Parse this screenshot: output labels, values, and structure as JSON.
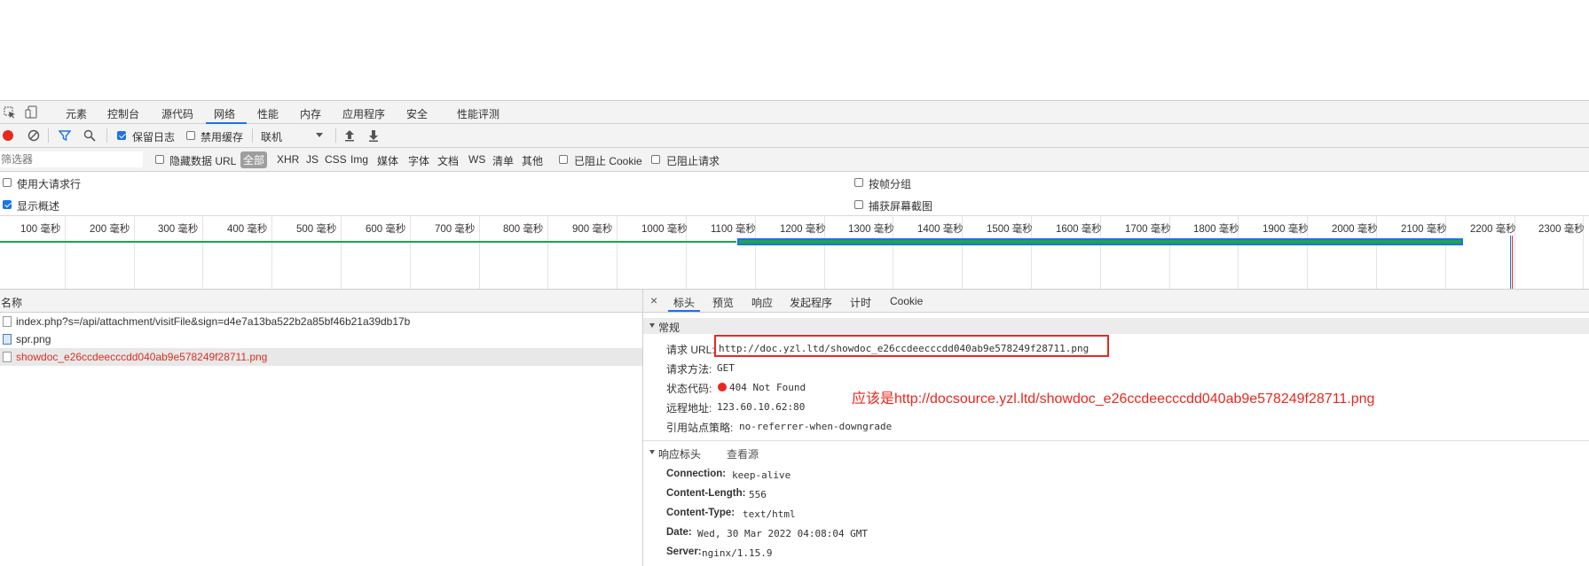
{
  "tabs": {
    "items": [
      "元素",
      "控制台",
      "源代码",
      "网络",
      "性能",
      "内存",
      "应用程序",
      "安全",
      "性能评测"
    ],
    "active_index": 3
  },
  "toolbar": {
    "preserve_log": "保留日志",
    "disable_cache": "禁用缓存",
    "throttling": "联机"
  },
  "filterbar": {
    "placeholder": "筛选器",
    "hide_data_url": "隐藏数据 URL",
    "all": "全部",
    "types": [
      "XHR",
      "JS",
      "CSS",
      "Img",
      "媒体",
      "字体",
      "文档",
      "WS",
      "清单",
      "其他"
    ],
    "blocked_cookies": "已阻止 Cookie",
    "blocked_requests": "已阻止请求"
  },
  "options": {
    "large_rows": "使用大请求行",
    "show_overview": "显示概述",
    "group_by_frame": "按帧分组",
    "capture_screenshots": "捕获屏幕截图"
  },
  "timeline": {
    "labels": [
      "100 毫秒",
      "200 毫秒",
      "300 毫秒",
      "400 毫秒",
      "500 毫秒",
      "600 毫秒",
      "700 毫秒",
      "800 毫秒",
      "900 毫秒",
      "1000 毫秒",
      "1100 毫秒",
      "1200 毫秒",
      "1300 毫秒",
      "1400 毫秒",
      "1500 毫秒",
      "1600 毫秒",
      "1700 毫秒",
      "1800 毫秒",
      "1900 毫秒",
      "2000 毫秒",
      "2100 毫秒",
      "2200 毫秒",
      "2300 毫秒"
    ]
  },
  "requests": {
    "header": "名称",
    "rows": [
      {
        "name": "index.php?s=/api/attachment/visitFile&sign=d4e7a13ba522b2a85bf46b21a39db17b",
        "error": false
      },
      {
        "name": "spr.png",
        "error": false
      },
      {
        "name": "showdoc_e26ccdeecccdd040ab9e578249f28711.png",
        "error": true
      }
    ]
  },
  "details": {
    "tabs": [
      "标头",
      "预览",
      "响应",
      "发起程序",
      "计时",
      "Cookie"
    ],
    "active_tab": 0,
    "general": {
      "title": "常规",
      "request_url_label": "请求 URL:",
      "request_url": "http://doc.yzl.ltd/showdoc_e26ccdeecccdd040ab9e578249f28711.png",
      "method_label": "请求方法:",
      "method": "GET",
      "status_label": "状态代码:",
      "status": "404 Not Found",
      "remote_label": "远程地址:",
      "remote": "123.60.10.62:80",
      "referrer_label": "引用站点策略:",
      "referrer": "no-referrer-when-downgrade"
    },
    "annotation": "应该是http://docsource.yzl.ltd/showdoc_e26ccdeecccdd040ab9e578249f28711.png",
    "response_headers": {
      "title": "响应标头",
      "view_source": "查看源",
      "items": [
        {
          "k": "Connection:",
          "v": "keep-alive"
        },
        {
          "k": "Content-Length:",
          "v": "556"
        },
        {
          "k": "Content-Type:",
          "v": "text/html"
        },
        {
          "k": "Date:",
          "v": "Wed, 30 Mar 2022 04:08:04 GMT"
        },
        {
          "k": "Server:",
          "v": "nginx/1.15.9"
        }
      ]
    }
  },
  "colors": {
    "accent": "#1a73e8",
    "error": "#d93025",
    "annotation": "#e8281e",
    "record": "#e8281e",
    "bar_green": "#21a34a",
    "bar_blue": "#1a73e8"
  }
}
